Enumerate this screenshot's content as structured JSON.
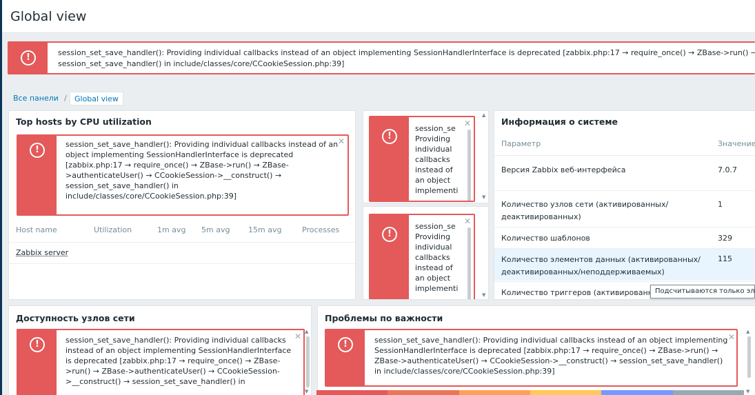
{
  "page": {
    "title": "Global view"
  },
  "top_message": {
    "line1": "session_set_save_handler(): Providing individual callbacks instead of an object implementing SessionHandlerInterface is deprecated [zabbix.php:17 → require_once() → ZBase->run() → Z",
    "line2": "session_set_save_handler() in include/classes/core/CCookieSession.php:39]"
  },
  "breadcrumb": {
    "link": "Все панели",
    "separator": "/",
    "current": "Global view"
  },
  "widgets": {
    "top_hosts": {
      "title": "Top hosts by CPU utilization",
      "message": "session_set_save_handler(): Providing individual callbacks instead of an\nobject implementing SessionHandlerInterface is deprecated\n[zabbix.php:17 → require_once() → ZBase->run() → ZBase-\n>authenticateUser() → CCookieSession->__construct() →\nsession_set_save_handler() in\ninclude/classes/core/CCookieSession.php:39]",
      "columns": [
        "Host name",
        "Utilization",
        "1m avg",
        "5m avg",
        "15m avg",
        "Processes"
      ],
      "rows": [
        {
          "host": "Zabbix server"
        }
      ]
    },
    "narrow_1": {
      "message": "session_se\nProviding\nindividual\ncallbacks\ninstead of\nan object\nimplementi"
    },
    "narrow_2": {
      "message": "session_se\nProviding\nindividual\ncallbacks\ninstead of\nan object\nimplementi"
    },
    "system_info": {
      "title": "Информация о системе",
      "col_param": "Параметр",
      "col_value": "Значение",
      "rows": [
        {
          "param": "Версия Zabbix веб-интерфейса",
          "value": "7.0.7"
        },
        {
          "param": "Количество узлов сети (активированных/\nдеактивированных)",
          "value": "1"
        },
        {
          "param": "Количество шаблонов",
          "value": "329"
        },
        {
          "param": "Количество элементов данных (активированных/\nдеактивированных/неподдерживаемых)",
          "value": "115"
        },
        {
          "param": "Количество триггеров (активированн",
          "value": ""
        }
      ]
    },
    "availability": {
      "title": "Доступность узлов сети",
      "message": "session_set_save_handler(): Providing individual callbacks\ninstead of an object implementing SessionHandlerInterface\nis deprecated [zabbix.php:17 → require_once() → ZBase-\n>run() → ZBase->authenticateUser() → CCookieSession-\n>__construct() → session_set_save_handler() in"
    },
    "problems": {
      "title": "Проблемы по важности",
      "message": "session_set_save_handler(): Providing individual callbacks instead of an object implementing\nSessionHandlerInterface is deprecated [zabbix.php:17 → require_once() → ZBase->run() →\nZBase->authenticateUser() → CCookieSession->__construct() → session_set_save_handler()\nin include/classes/core/CCookieSession.php:39]"
    }
  },
  "tooltip": {
    "text": "Подсчитываются только элем"
  },
  "icons": {
    "alert": "exclamation-circle-icon",
    "close": "close-icon"
  },
  "colors": {
    "error_red": "#e45959",
    "link_blue": "#0275b8",
    "highlight_row": "#e8f5ff",
    "severity": [
      "#97aab3",
      "#7499ff",
      "#ffc859",
      "#ffa059",
      "#e97659",
      "#e45959"
    ]
  }
}
